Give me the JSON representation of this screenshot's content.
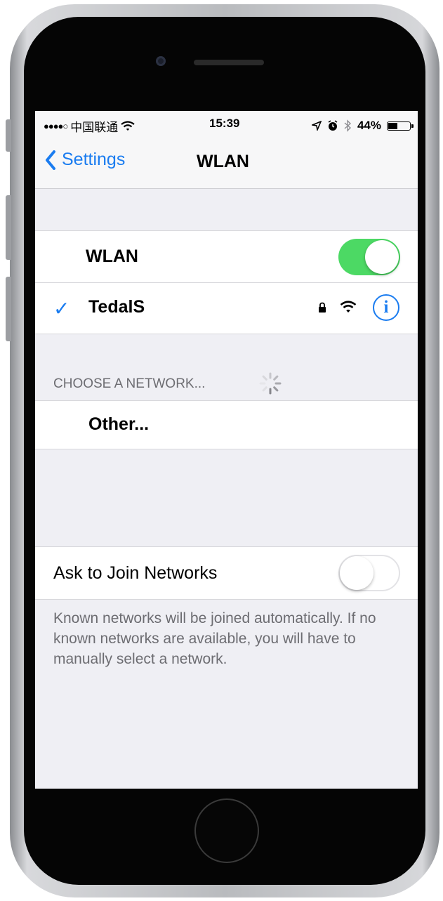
{
  "status_bar": {
    "signal": "●●●●○",
    "carrier": "中国联通",
    "time": "15:39",
    "battery_percent": "44%",
    "battery_level": 0.44,
    "icons": [
      "wifi-icon",
      "location-arrow-icon",
      "alarm-icon",
      "bluetooth-icon",
      "battery-icon"
    ]
  },
  "nav": {
    "back_label": "Settings",
    "title": "WLAN"
  },
  "wlan": {
    "label": "WLAN",
    "enabled": true
  },
  "connected_network": {
    "name": "TedalS",
    "secured": true,
    "selected": true
  },
  "choose_network": {
    "header": "CHOOSE A NETWORK...",
    "other_label": "Other..."
  },
  "ask_to_join": {
    "label": "Ask to Join Networks",
    "enabled": false,
    "footer": "Known networks will be joined automatically. If no known networks are available, you will have to manually select a network."
  },
  "colors": {
    "accent": "#1a7cf0",
    "toggle_on": "#4cd964",
    "background": "#efeff4"
  }
}
